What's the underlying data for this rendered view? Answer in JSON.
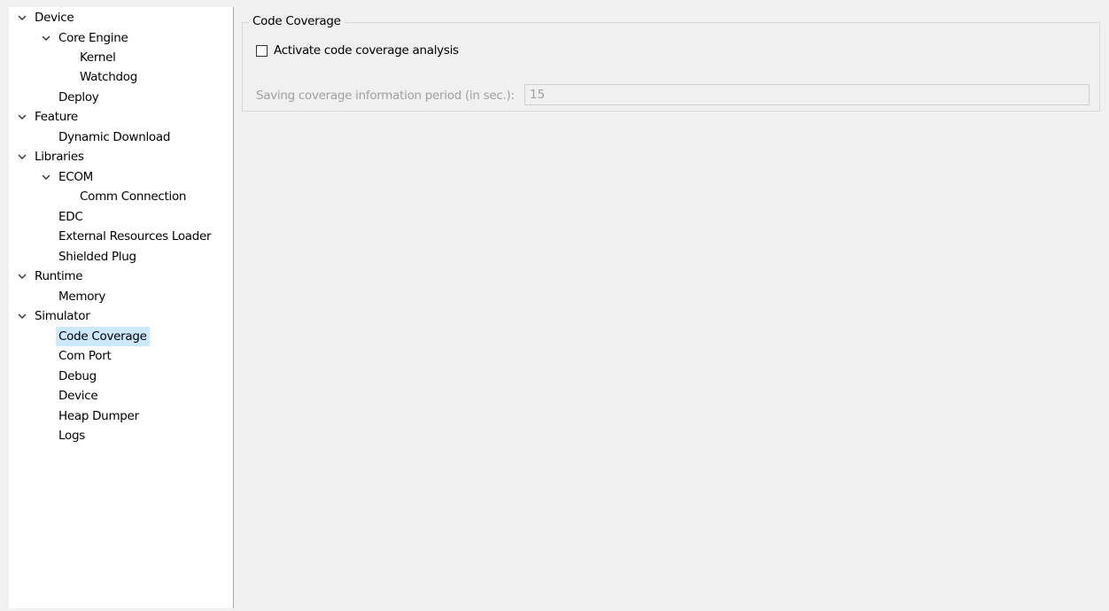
{
  "tree": {
    "items": [
      {
        "label": "Device",
        "expanded": true
      },
      {
        "label": "Core Engine",
        "expanded": true
      },
      {
        "label": "Kernel"
      },
      {
        "label": "Watchdog"
      },
      {
        "label": "Deploy"
      },
      {
        "label": "Feature",
        "expanded": true
      },
      {
        "label": "Dynamic Download"
      },
      {
        "label": "Libraries",
        "expanded": true
      },
      {
        "label": "ECOM",
        "expanded": true
      },
      {
        "label": "Comm Connection"
      },
      {
        "label": "EDC"
      },
      {
        "label": "External Resources Loader"
      },
      {
        "label": "Shielded Plug"
      },
      {
        "label": "Runtime",
        "expanded": true
      },
      {
        "label": "Memory"
      },
      {
        "label": "Simulator",
        "expanded": true
      },
      {
        "label": "Code Coverage",
        "selected": true
      },
      {
        "label": "Com Port"
      },
      {
        "label": "Debug"
      },
      {
        "label": "Device"
      },
      {
        "label": "Heap Dumper"
      },
      {
        "label": "Logs"
      }
    ],
    "chevron_icon": "chevron-down-icon",
    "selection_color": "#cce8ff"
  },
  "panel": {
    "group_title": "Code Coverage",
    "activate_label": "Activate code coverage analysis",
    "activate_checked": false,
    "period_label": "Saving coverage information period (in sec.):",
    "period_value": "15",
    "period_enabled": false
  }
}
